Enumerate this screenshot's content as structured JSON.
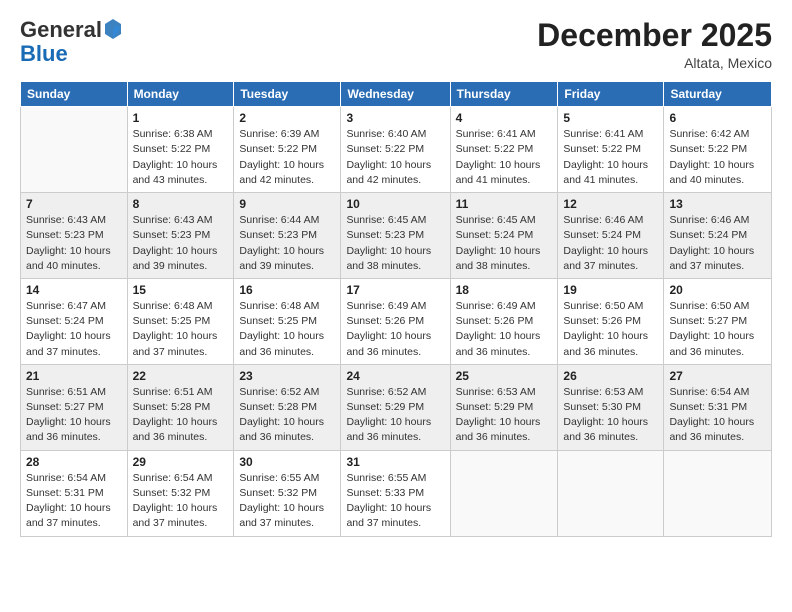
{
  "header": {
    "logo_general": "General",
    "logo_blue": "Blue",
    "month_year": "December 2025",
    "location": "Altata, Mexico"
  },
  "weekdays": [
    "Sunday",
    "Monday",
    "Tuesday",
    "Wednesday",
    "Thursday",
    "Friday",
    "Saturday"
  ],
  "weeks": [
    [
      {
        "day": "",
        "info": ""
      },
      {
        "day": "1",
        "info": "Sunrise: 6:38 AM\nSunset: 5:22 PM\nDaylight: 10 hours\nand 43 minutes."
      },
      {
        "day": "2",
        "info": "Sunrise: 6:39 AM\nSunset: 5:22 PM\nDaylight: 10 hours\nand 42 minutes."
      },
      {
        "day": "3",
        "info": "Sunrise: 6:40 AM\nSunset: 5:22 PM\nDaylight: 10 hours\nand 42 minutes."
      },
      {
        "day": "4",
        "info": "Sunrise: 6:41 AM\nSunset: 5:22 PM\nDaylight: 10 hours\nand 41 minutes."
      },
      {
        "day": "5",
        "info": "Sunrise: 6:41 AM\nSunset: 5:22 PM\nDaylight: 10 hours\nand 41 minutes."
      },
      {
        "day": "6",
        "info": "Sunrise: 6:42 AM\nSunset: 5:22 PM\nDaylight: 10 hours\nand 40 minutes."
      }
    ],
    [
      {
        "day": "7",
        "info": "Sunrise: 6:43 AM\nSunset: 5:23 PM\nDaylight: 10 hours\nand 40 minutes."
      },
      {
        "day": "8",
        "info": "Sunrise: 6:43 AM\nSunset: 5:23 PM\nDaylight: 10 hours\nand 39 minutes."
      },
      {
        "day": "9",
        "info": "Sunrise: 6:44 AM\nSunset: 5:23 PM\nDaylight: 10 hours\nand 39 minutes."
      },
      {
        "day": "10",
        "info": "Sunrise: 6:45 AM\nSunset: 5:23 PM\nDaylight: 10 hours\nand 38 minutes."
      },
      {
        "day": "11",
        "info": "Sunrise: 6:45 AM\nSunset: 5:24 PM\nDaylight: 10 hours\nand 38 minutes."
      },
      {
        "day": "12",
        "info": "Sunrise: 6:46 AM\nSunset: 5:24 PM\nDaylight: 10 hours\nand 37 minutes."
      },
      {
        "day": "13",
        "info": "Sunrise: 6:46 AM\nSunset: 5:24 PM\nDaylight: 10 hours\nand 37 minutes."
      }
    ],
    [
      {
        "day": "14",
        "info": "Sunrise: 6:47 AM\nSunset: 5:24 PM\nDaylight: 10 hours\nand 37 minutes."
      },
      {
        "day": "15",
        "info": "Sunrise: 6:48 AM\nSunset: 5:25 PM\nDaylight: 10 hours\nand 37 minutes."
      },
      {
        "day": "16",
        "info": "Sunrise: 6:48 AM\nSunset: 5:25 PM\nDaylight: 10 hours\nand 36 minutes."
      },
      {
        "day": "17",
        "info": "Sunrise: 6:49 AM\nSunset: 5:26 PM\nDaylight: 10 hours\nand 36 minutes."
      },
      {
        "day": "18",
        "info": "Sunrise: 6:49 AM\nSunset: 5:26 PM\nDaylight: 10 hours\nand 36 minutes."
      },
      {
        "day": "19",
        "info": "Sunrise: 6:50 AM\nSunset: 5:26 PM\nDaylight: 10 hours\nand 36 minutes."
      },
      {
        "day": "20",
        "info": "Sunrise: 6:50 AM\nSunset: 5:27 PM\nDaylight: 10 hours\nand 36 minutes."
      }
    ],
    [
      {
        "day": "21",
        "info": "Sunrise: 6:51 AM\nSunset: 5:27 PM\nDaylight: 10 hours\nand 36 minutes."
      },
      {
        "day": "22",
        "info": "Sunrise: 6:51 AM\nSunset: 5:28 PM\nDaylight: 10 hours\nand 36 minutes."
      },
      {
        "day": "23",
        "info": "Sunrise: 6:52 AM\nSunset: 5:28 PM\nDaylight: 10 hours\nand 36 minutes."
      },
      {
        "day": "24",
        "info": "Sunrise: 6:52 AM\nSunset: 5:29 PM\nDaylight: 10 hours\nand 36 minutes."
      },
      {
        "day": "25",
        "info": "Sunrise: 6:53 AM\nSunset: 5:29 PM\nDaylight: 10 hours\nand 36 minutes."
      },
      {
        "day": "26",
        "info": "Sunrise: 6:53 AM\nSunset: 5:30 PM\nDaylight: 10 hours\nand 36 minutes."
      },
      {
        "day": "27",
        "info": "Sunrise: 6:54 AM\nSunset: 5:31 PM\nDaylight: 10 hours\nand 36 minutes."
      }
    ],
    [
      {
        "day": "28",
        "info": "Sunrise: 6:54 AM\nSunset: 5:31 PM\nDaylight: 10 hours\nand 37 minutes."
      },
      {
        "day": "29",
        "info": "Sunrise: 6:54 AM\nSunset: 5:32 PM\nDaylight: 10 hours\nand 37 minutes."
      },
      {
        "day": "30",
        "info": "Sunrise: 6:55 AM\nSunset: 5:32 PM\nDaylight: 10 hours\nand 37 minutes."
      },
      {
        "day": "31",
        "info": "Sunrise: 6:55 AM\nSunset: 5:33 PM\nDaylight: 10 hours\nand 37 minutes."
      },
      {
        "day": "",
        "info": ""
      },
      {
        "day": "",
        "info": ""
      },
      {
        "day": "",
        "info": ""
      }
    ]
  ]
}
